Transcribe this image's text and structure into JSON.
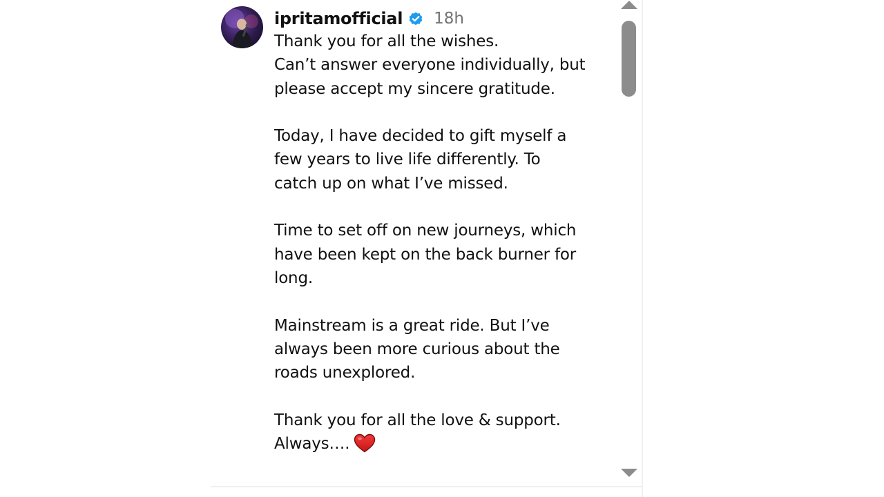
{
  "post": {
    "username": "ipritamofficial",
    "verified_icon": "verified-badge-icon",
    "time": "18h",
    "accent_color": "#1d9bf0",
    "caption": {
      "lines": [
        "Thank you for all the wishes.",
        "Can’t answer everyone individually, but",
        "please accept my sincere gratitude.",
        "Today, I have decided to gift myself a",
        "few years to live life differently. To",
        "catch up on what I’ve missed.",
        "Time to set off on new journeys, which",
        "have been kept on the back burner for",
        "long.",
        "Mainstream is a great ride. But I’ve",
        "always been more curious about the",
        "roads unexplored.",
        "Thank you for all the love & support.",
        "Always…."
      ],
      "end_emoji": "heart-icon"
    }
  },
  "scrollbar": {
    "up_icon": "scroll-up-arrow-icon",
    "down_icon": "scroll-down-arrow-icon"
  }
}
